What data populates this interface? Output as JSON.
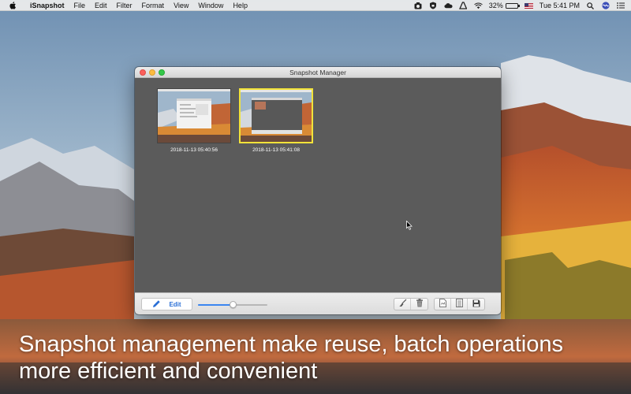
{
  "menubar": {
    "app_name": "iSnapshot",
    "menus": [
      "File",
      "Edit",
      "Filter",
      "Format",
      "View",
      "Window",
      "Help"
    ],
    "battery_percent": "32%",
    "battery_level": 0.32,
    "clock": "Tue 5:41 PM"
  },
  "window": {
    "title": "Snapshot Manager",
    "snapshots": [
      {
        "timestamp": "2018-11-13 05:40:56",
        "selected": false
      },
      {
        "timestamp": "2018-11-13 05:41:08",
        "selected": true
      }
    ],
    "toolbar": {
      "edit_label": "Edit",
      "zoom_level": 0.5
    }
  },
  "caption": {
    "line1": "Snapshot management make reuse, batch operations",
    "line2": "more efficient and convenient"
  },
  "colors": {
    "selection_border": "#f2e33a",
    "accent": "#3a86f0",
    "window_bg": "#5b5b5b"
  },
  "icons": [
    "apple-icon",
    "pencil-icon",
    "brush-icon",
    "trash-icon",
    "document-icon",
    "list-icon",
    "save-icon",
    "wifi-icon",
    "search-icon",
    "siri-icon",
    "menu-list-icon"
  ]
}
